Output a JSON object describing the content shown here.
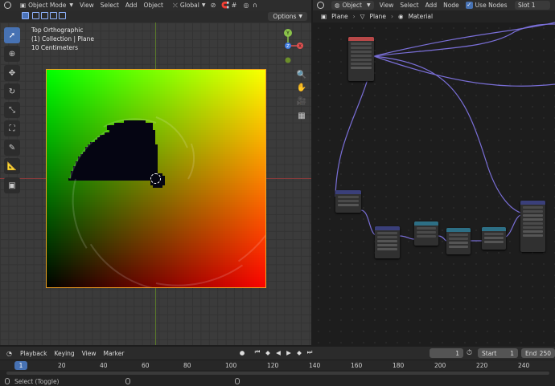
{
  "viewport": {
    "header": {
      "mode": "Object Mode",
      "menus": [
        "View",
        "Select",
        "Add",
        "Object"
      ],
      "transform_orientation": "Global"
    },
    "options_label": "Options",
    "overlay": {
      "line1": "Top Orthographic",
      "line2": "(1) Collection | Plane",
      "line3": "10 Centimeters"
    },
    "gizmo": {
      "x": "X",
      "y": "Y",
      "z": "Z"
    }
  },
  "editor": {
    "header": {
      "type": "Object",
      "menus": [
        "View",
        "Select",
        "Add",
        "Node"
      ],
      "use_nodes": "Use Nodes",
      "slot": "Slot 1"
    },
    "breadcrumb": [
      "Plane",
      "Plane",
      "Material"
    ]
  },
  "timeline": {
    "menus": [
      "Playback",
      "Keying",
      "View",
      "Marker"
    ],
    "current_frame": "1",
    "start_label": "Start",
    "start_value": "1",
    "end_label": "End",
    "end_value": "250",
    "ruler": [
      "1",
      "20",
      "40",
      "60",
      "80",
      "100",
      "120",
      "140",
      "160",
      "180",
      "200",
      "220",
      "240"
    ]
  },
  "statusbar": {
    "hint": "Select (Toggle)"
  },
  "colors": {
    "accent": "#4772b3",
    "selection_outline": "#f0a020",
    "wire": "#7a6fd8"
  }
}
